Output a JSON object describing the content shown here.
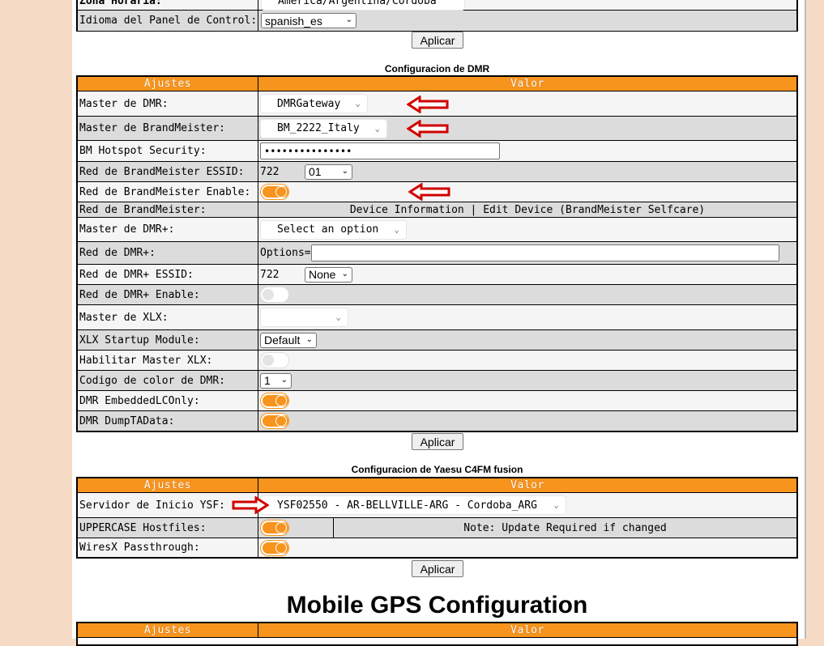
{
  "top_section": {
    "partial_row_label": "Zona Horaria:",
    "partial_row_value": "America/Argentina/Cordoba",
    "language_label": "Idioma del Panel de Control:",
    "language_value": "spanish_es",
    "apply_label": "Aplicar"
  },
  "dmr_section": {
    "title": "Configuracion de DMR",
    "header_settings": "Ajustes",
    "header_value": "Valor",
    "rows": {
      "dmr_master_label": "Master de DMR:",
      "dmr_master_value": "DMRGateway",
      "bm_master_label": "Master de BrandMeister:",
      "bm_master_value": "BM_2222_Italy",
      "bm_security_label": "BM Hotspot Security:",
      "bm_security_value": "•••••••••••••••",
      "bm_essid_label": "Red de BrandMeister ESSID:",
      "bm_essid_prefix": "722",
      "bm_essid_value": "01",
      "bm_enable_label": "Red de BrandMeister Enable:",
      "bm_network_label": "Red de BrandMeister:",
      "bm_network_links": "Device Information | Edit Device (BrandMeister Selfcare)",
      "dmrplus_master_label": "Master de DMR+:",
      "dmrplus_master_value": "Select an option",
      "dmrplus_net_label": "Red de DMR+:",
      "dmrplus_net_prefix": "Options=",
      "dmrplus_essid_label": "Red de DMR+ ESSID:",
      "dmrplus_essid_prefix": "722",
      "dmrplus_essid_value": "None",
      "dmrplus_enable_label": "Red de DMR+ Enable:",
      "xlx_master_label": "Master de XLX:",
      "xlx_master_value": "",
      "xlx_startup_label": "XLX Startup Module:",
      "xlx_startup_value": "Default",
      "xlx_enable_label": "Habilitar Master XLX:",
      "color_code_label": "Codigo de color de DMR:",
      "color_code_value": "1",
      "embedded_label": "DMR EmbeddedLCOnly:",
      "dumpta_label": "DMR DumpTAData:"
    },
    "toggles": {
      "bm_enable": true,
      "dmrplus_enable": false,
      "xlx_enable": false,
      "embedded": true,
      "dumpta": true
    },
    "apply_label": "Aplicar"
  },
  "ysf_section": {
    "title": "Configuracion de Yaesu C4FM fusion",
    "header_settings": "Ajustes",
    "header_value": "Valor",
    "server_label": "Servidor de Inicio YSF:",
    "server_value": "YSF02550 - AR-BELLVILLE-ARG - Cordoba_ARG",
    "uppercase_label": "UPPERCASE Hostfiles:",
    "uppercase_note": "Note: Update Required if changed",
    "wiresx_label": "WiresX Passthrough:",
    "toggles": {
      "uppercase": true,
      "wiresx": true
    },
    "apply_label": "Aplicar"
  },
  "gps_section": {
    "title": "Mobile GPS Configuration",
    "header_settings": "Ajustes",
    "header_value": "Valor"
  },
  "colors": {
    "header_orange": "#f7941d",
    "annotation_arrow": "#d10000",
    "page_background": "#f6dcc6"
  }
}
